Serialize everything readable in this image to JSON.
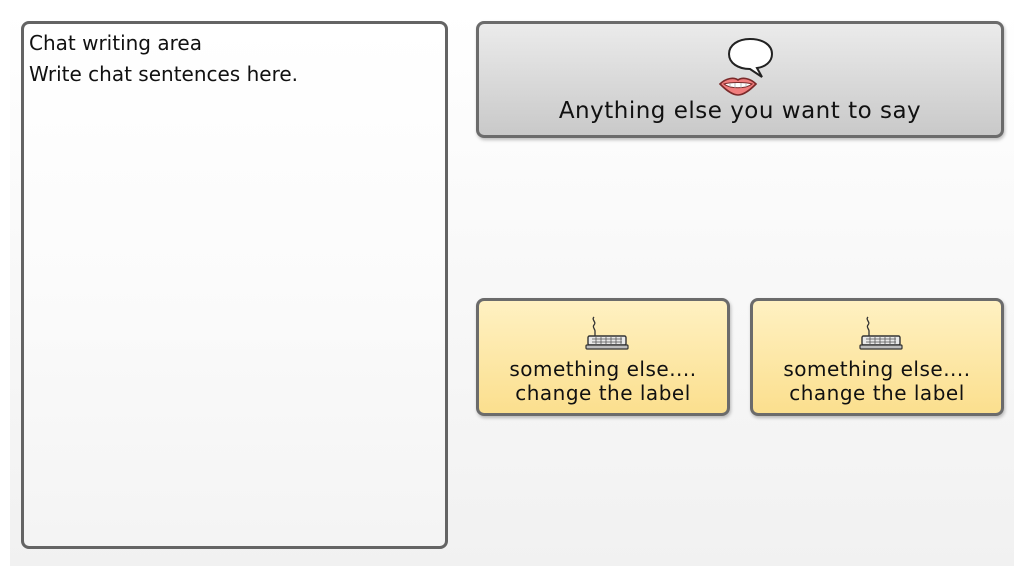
{
  "chat_area": {
    "lines": [
      "Chat writing area",
      "Write chat sentences here."
    ]
  },
  "buttons": {
    "say": {
      "label": "Anything else you want to say",
      "icon": "speech-bubble-mouth-icon"
    },
    "custom": [
      {
        "line1": "something else....",
        "line2": "change the label",
        "icon": "keyboard-icon"
      },
      {
        "line1": "something else....",
        "line2": "change the label",
        "icon": "keyboard-icon"
      }
    ]
  },
  "colors": {
    "border": "#646464",
    "say_button": "#d9d9d9",
    "custom_button": "#fbe3a0"
  }
}
